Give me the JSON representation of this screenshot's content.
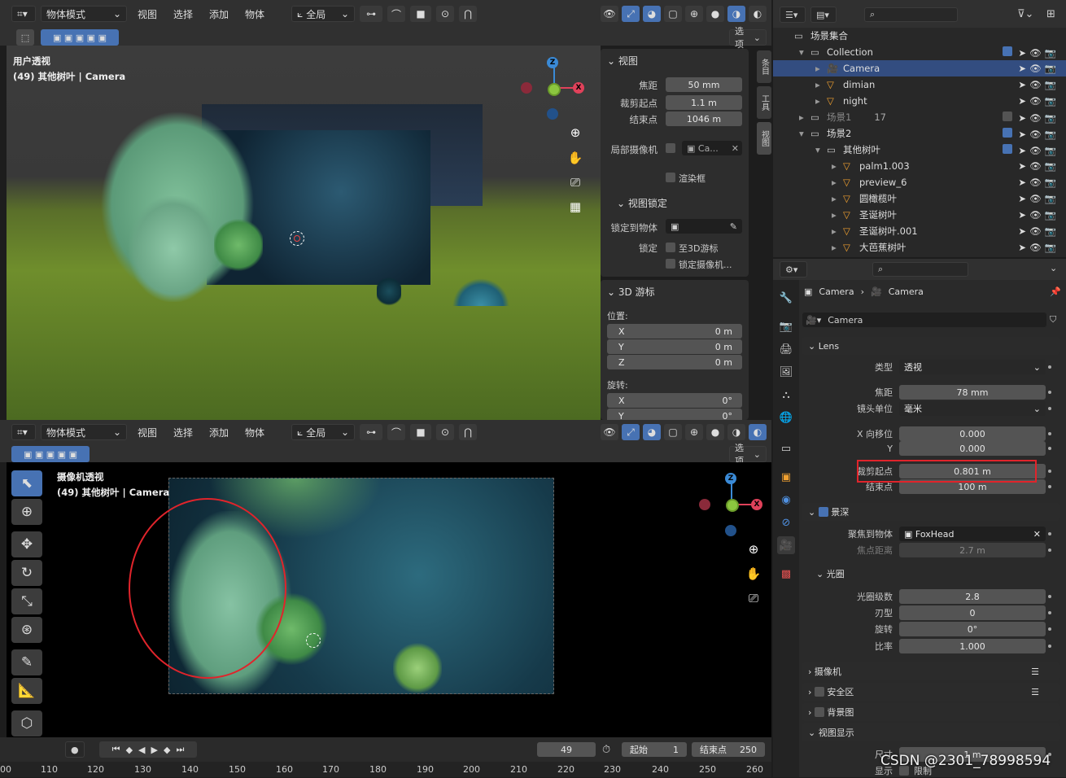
{
  "top_viewport": {
    "mode": "物体模式",
    "menus": [
      "视图",
      "选择",
      "添加",
      "物体"
    ],
    "transform": "全局",
    "options": "选项",
    "view_label": "用户透视",
    "view_sub": "(49) 其他树叶 | Camera",
    "npanel": {
      "view_header": "视图",
      "focal_label": "焦距",
      "focal_value": "50 mm",
      "clip_start_label": "裁剪起点",
      "clip_start_value": "1.1 m",
      "clip_end_label": "结束点",
      "clip_end_value": "1046 m",
      "local_camera_label": "局部摄像机",
      "local_camera_value": "Ca...",
      "render_region": "渲染框",
      "view_lock_header": "视图锁定",
      "lock_object_label": "锁定到物体",
      "lock_label": "锁定",
      "to_3d_cursor": "至3D游标",
      "lock_camera": "锁定摄像机...",
      "cursor_header": "3D 游标",
      "location": "位置:",
      "x_label": "X",
      "x_value": "0 m",
      "y_label": "Y",
      "y_value": "0 m",
      "z_label": "Z",
      "z_value": "0 m",
      "rotation": "旋转:",
      "rx_label": "X",
      "rx_value": "0°",
      "ry_label": "Y",
      "ry_value": "0°"
    },
    "side_tabs": [
      "条目",
      "工具",
      "视图"
    ]
  },
  "bottom_viewport": {
    "mode": "物体模式",
    "menus": [
      "视图",
      "选择",
      "添加",
      "物体"
    ],
    "transform": "全局",
    "options": "选项",
    "view_label": "摄像机透视",
    "view_sub": "(49) 其他树叶 | Camera"
  },
  "timeline": {
    "frame": "49",
    "start_label": "起始",
    "start_value": "1",
    "end_label": "结束点",
    "end_value": "250",
    "ticks": [
      "00",
      "110",
      "120",
      "130",
      "140",
      "150",
      "160",
      "170",
      "180",
      "190",
      "200",
      "210",
      "220",
      "230",
      "240",
      "250",
      "260"
    ]
  },
  "outliner": {
    "items": [
      {
        "name": "场景集合",
        "indent": 0
      },
      {
        "name": "Collection",
        "indent": 1
      },
      {
        "name": "Camera",
        "indent": 2
      },
      {
        "name": "dimian",
        "indent": 2
      },
      {
        "name": "night",
        "indent": 2
      },
      {
        "name": "场景1",
        "indent": 1
      },
      {
        "name": "场景2",
        "indent": 1
      },
      {
        "name": "其他树叶",
        "indent": 2
      },
      {
        "name": "palm1.003",
        "indent": 3
      },
      {
        "name": "preview_6",
        "indent": 3
      },
      {
        "name": "圆橄榄叶",
        "indent": 3
      },
      {
        "name": "圣诞树叶",
        "indent": 3
      },
      {
        "name": "圣诞树叶.001",
        "indent": 3
      },
      {
        "name": "大芭蕉树叶",
        "indent": 3
      }
    ],
    "badge_17": "17"
  },
  "properties": {
    "breadcrumb_obj": "Camera",
    "breadcrumb_data": "Camera",
    "datablock": "Camera",
    "lens_header": "Lens",
    "type_label": "类型",
    "type_value": "透视",
    "focal_label": "焦距",
    "focal_value": "78 mm",
    "unit_label": "镜头单位",
    "unit_value": "毫米",
    "shiftx_label": "X 向移位",
    "shiftx_value": "0.000",
    "shifty_label": "Y",
    "shifty_value": "0.000",
    "clip_start_label": "裁剪起点",
    "clip_start_value": "0.801 m",
    "clip_end_label": "结束点",
    "clip_end_value": "100 m",
    "dof_header": "景深",
    "focus_obj_label": "聚焦到物体",
    "focus_obj_value": "FoxHead",
    "focus_dist_label": "焦点距离",
    "focus_dist_value": "2.7 m",
    "aperture_header": "光圈",
    "fstop_label": "光圈级数",
    "fstop_value": "2.8",
    "blades_label": "刃型",
    "blades_value": "0",
    "rotation_label": "旋转",
    "rotation_value": "0°",
    "ratio_label": "比率",
    "ratio_value": "1.000",
    "camera_header": "摄像机",
    "safe_header": "安全区",
    "bg_header": "背景图",
    "display_header": "视图显示",
    "size_label": "尺寸",
    "size_value": "1 m",
    "show_label": "显示",
    "limits": "限制"
  },
  "watermark": "CSDN @2301_78998594",
  "colors": {
    "accent": "#4772b3",
    "highlight_box": "#e0242b",
    "x_axis": "#e0415a",
    "y_axis": "#8cc63f",
    "z_axis": "#3a8ad6"
  }
}
